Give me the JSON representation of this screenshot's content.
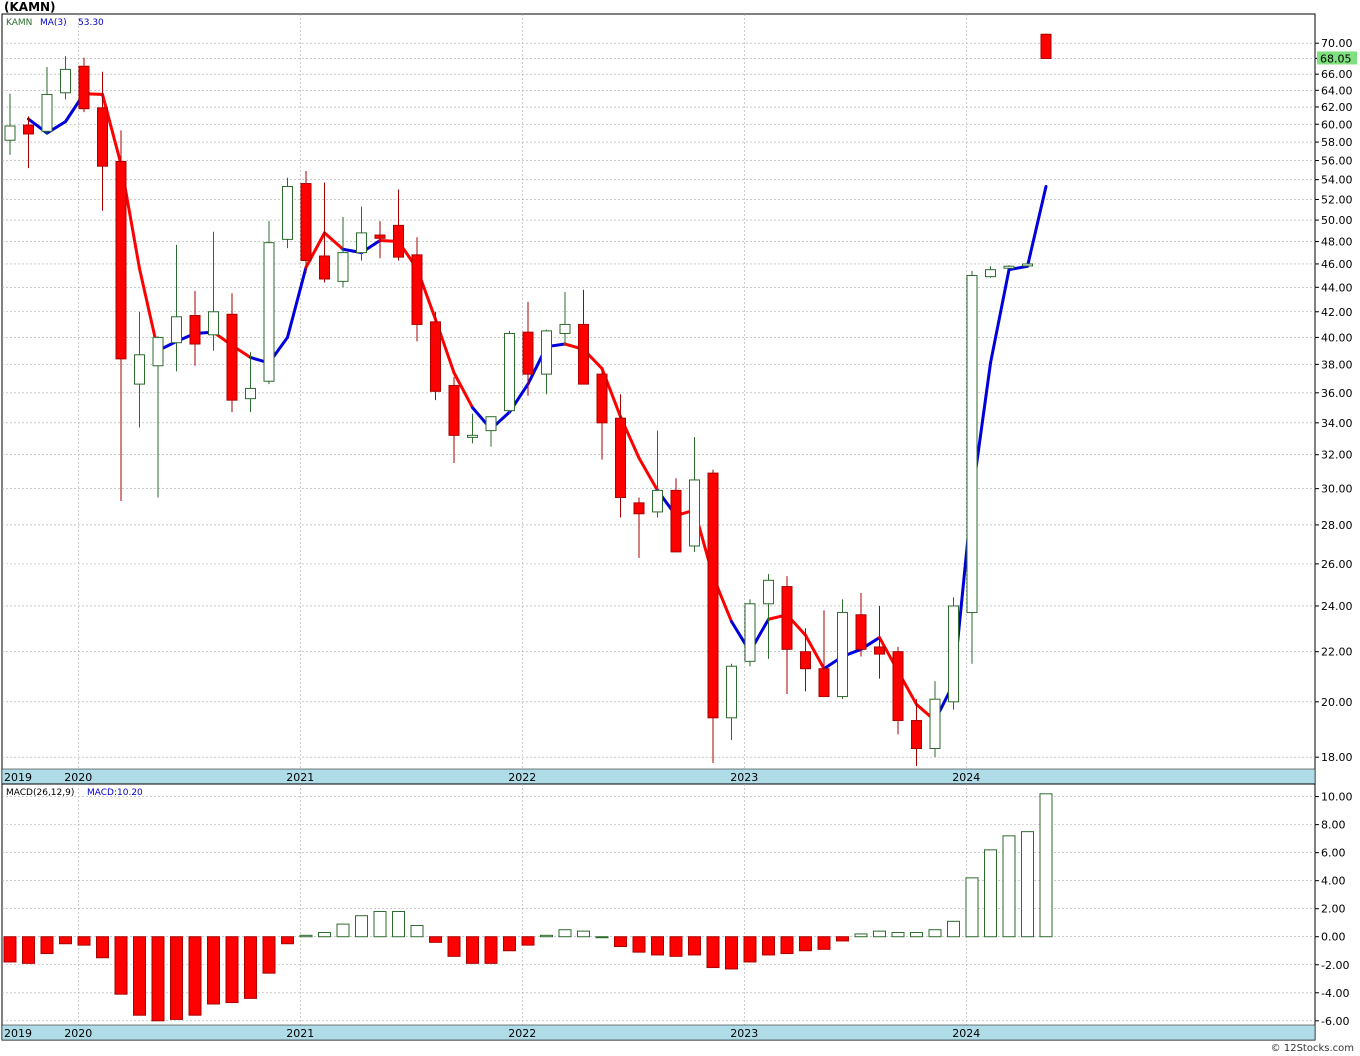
{
  "title": "(KAMN)",
  "watermark": "© 12Stocks.com",
  "colors": {
    "up_candle": "#2e6b2e",
    "down_candle": "#ff0000",
    "ma_up": "#0000dd",
    "ma_down": "#ff0000",
    "year_band": "#b0dce8",
    "last_price_badge": "#7ee07e",
    "grid": "#aaaaaa"
  },
  "chart_data": [
    {
      "type": "candlestick",
      "legend": {
        "symbol": "KAMN",
        "ma_label": "MA(3)",
        "ma_value": "53.30"
      },
      "last_price_label": "68.05",
      "ylim": [
        17.6,
        74.0
      ],
      "y_scale": "log",
      "y_ticks": [
        "18.00",
        "20.00",
        "22.00",
        "24.00",
        "26.00",
        "28.00",
        "30.00",
        "32.00",
        "34.00",
        "36.00",
        "38.00",
        "40.00",
        "42.00",
        "44.00",
        "46.00",
        "48.00",
        "50.00",
        "52.00",
        "54.00",
        "56.00",
        "58.00",
        "60.00",
        "62.00",
        "64.00",
        "66.00",
        "68.00",
        "70.00"
      ],
      "x_year_labels": [
        {
          "label": "2019",
          "index": -0.3
        },
        {
          "label": "2020",
          "index": 3.8
        },
        {
          "label": "2021",
          "index": 15.8
        },
        {
          "label": "2022",
          "index": 27.8
        },
        {
          "label": "2023",
          "index": 39.8
        },
        {
          "label": "2024",
          "index": 51.8
        }
      ],
      "candles": [
        {
          "o": 58.2,
          "h": 63.6,
          "l": 56.6,
          "c": 59.8
        },
        {
          "o": 59.9,
          "h": 60.9,
          "l": 55.2,
          "c": 58.9
        },
        {
          "o": 59.2,
          "h": 66.9,
          "l": 58.8,
          "c": 63.5
        },
        {
          "o": 63.7,
          "h": 68.3,
          "l": 62.9,
          "c": 66.6
        },
        {
          "o": 67.0,
          "h": 68.1,
          "l": 61.4,
          "c": 61.8
        },
        {
          "o": 61.9,
          "h": 66.3,
          "l": 50.9,
          "c": 55.4
        },
        {
          "o": 55.9,
          "h": 59.3,
          "l": 29.3,
          "c": 38.4
        },
        {
          "o": 36.6,
          "h": 42.0,
          "l": 33.7,
          "c": 38.7
        },
        {
          "o": 37.9,
          "h": 40.1,
          "l": 29.5,
          "c": 40.0
        },
        {
          "o": 39.6,
          "h": 47.7,
          "l": 37.5,
          "c": 41.6
        },
        {
          "o": 41.7,
          "h": 43.7,
          "l": 37.9,
          "c": 39.5
        },
        {
          "o": 40.2,
          "h": 48.9,
          "l": 39.0,
          "c": 42.0
        },
        {
          "o": 41.8,
          "h": 43.5,
          "l": 34.7,
          "c": 35.5
        },
        {
          "o": 35.6,
          "h": 38.9,
          "l": 34.7,
          "c": 36.3
        },
        {
          "o": 36.8,
          "h": 49.9,
          "l": 36.6,
          "c": 47.9
        },
        {
          "o": 48.2,
          "h": 54.2,
          "l": 47.4,
          "c": 53.3
        },
        {
          "o": 53.6,
          "h": 54.9,
          "l": 45.2,
          "c": 46.3
        },
        {
          "o": 46.7,
          "h": 53.7,
          "l": 44.4,
          "c": 44.7
        },
        {
          "o": 44.5,
          "h": 50.3,
          "l": 44.0,
          "c": 47.0
        },
        {
          "o": 47.0,
          "h": 51.3,
          "l": 46.3,
          "c": 48.8
        },
        {
          "o": 48.6,
          "h": 49.9,
          "l": 46.5,
          "c": 48.3
        },
        {
          "o": 49.5,
          "h": 53.0,
          "l": 46.3,
          "c": 46.6
        },
        {
          "o": 46.8,
          "h": 48.4,
          "l": 39.7,
          "c": 41.0
        },
        {
          "o": 41.2,
          "h": 42.0,
          "l": 35.5,
          "c": 36.1
        },
        {
          "o": 36.5,
          "h": 37.1,
          "l": 31.5,
          "c": 33.2
        },
        {
          "o": 33.2,
          "h": 34.6,
          "l": 32.7,
          "c": 33.2
        },
        {
          "o": 33.5,
          "h": 34.3,
          "l": 32.5,
          "c": 34.4
        },
        {
          "o": 34.8,
          "h": 40.5,
          "l": 34.6,
          "c": 40.3
        },
        {
          "o": 40.4,
          "h": 42.8,
          "l": 35.8,
          "c": 37.3
        },
        {
          "o": 37.3,
          "h": 40.6,
          "l": 35.9,
          "c": 40.5
        },
        {
          "o": 40.3,
          "h": 43.6,
          "l": 39.4,
          "c": 41.0
        },
        {
          "o": 41.0,
          "h": 43.8,
          "l": 36.6,
          "c": 36.6
        },
        {
          "o": 37.3,
          "h": 37.5,
          "l": 31.7,
          "c": 34.0
        },
        {
          "o": 34.3,
          "h": 35.9,
          "l": 28.4,
          "c": 29.5
        },
        {
          "o": 29.2,
          "h": 29.5,
          "l": 26.3,
          "c": 28.6
        },
        {
          "o": 28.7,
          "h": 33.5,
          "l": 28.4,
          "c": 29.9
        },
        {
          "o": 29.9,
          "h": 30.6,
          "l": 26.6,
          "c": 26.6
        },
        {
          "o": 26.9,
          "h": 33.1,
          "l": 26.6,
          "c": 30.5
        },
        {
          "o": 30.9,
          "h": 31.1,
          "l": 17.8,
          "c": 19.4
        },
        {
          "o": 19.4,
          "h": 21.5,
          "l": 18.6,
          "c": 21.4
        },
        {
          "o": 21.6,
          "h": 24.3,
          "l": 21.4,
          "c": 24.1
        },
        {
          "o": 24.1,
          "h": 25.5,
          "l": 21.7,
          "c": 25.2
        },
        {
          "o": 24.9,
          "h": 25.4,
          "l": 20.3,
          "c": 22.1
        },
        {
          "o": 22.0,
          "h": 23.0,
          "l": 20.4,
          "c": 21.3
        },
        {
          "o": 21.3,
          "h": 23.8,
          "l": 20.2,
          "c": 20.2
        },
        {
          "o": 20.2,
          "h": 24.3,
          "l": 20.1,
          "c": 23.7
        },
        {
          "o": 23.6,
          "h": 24.6,
          "l": 21.8,
          "c": 22.1
        },
        {
          "o": 22.2,
          "h": 24.0,
          "l": 20.9,
          "c": 21.9
        },
        {
          "o": 22.0,
          "h": 22.2,
          "l": 18.8,
          "c": 19.3
        },
        {
          "o": 19.3,
          "h": 20.1,
          "l": 17.7,
          "c": 18.3
        },
        {
          "o": 18.3,
          "h": 20.8,
          "l": 18.0,
          "c": 20.1
        },
        {
          "o": 20.0,
          "h": 24.4,
          "l": 19.7,
          "c": 24.0
        },
        {
          "o": 23.7,
          "h": 45.4,
          "l": 21.5,
          "c": 45.0
        },
        {
          "o": 44.9,
          "h": 45.8,
          "l": 44.8,
          "c": 45.5
        },
        {
          "o": 45.7,
          "h": 45.9,
          "l": 45.6,
          "c": 45.8
        },
        {
          "o": 45.9,
          "h": 46.0,
          "l": 45.9,
          "c": 46.0
        },
        {
          "o": 71.2,
          "h": 71.3,
          "l": 68.0,
          "c": 68.0
        }
      ],
      "ma3": [
        null,
        60.6,
        59.0,
        60.3,
        63.6,
        63.5,
        55.6,
        45.6,
        39.0,
        39.7,
        40.3,
        40.4,
        39.4,
        38.5,
        38.1,
        40.0,
        45.7,
        48.8,
        47.3,
        47.0,
        48.1,
        48.0,
        45.6,
        41.4,
        37.4,
        35.0,
        33.6,
        34.7,
        36.6,
        39.3,
        39.5,
        39.1,
        37.7,
        34.4,
        31.8,
        29.9,
        28.5,
        28.8,
        25.4,
        23.3,
        22.0,
        23.4,
        23.6,
        22.7,
        21.3,
        21.8,
        22.1,
        22.6,
        21.2,
        19.9,
        19.3,
        20.7,
        29.5,
        38.1,
        45.5,
        45.8,
        53.3
      ],
      "ma_color_series": [
        "",
        "red",
        "blue",
        "blue",
        "blue",
        "red",
        "red",
        "red",
        "red",
        "blue",
        "blue",
        "blue",
        "red",
        "red",
        "blue",
        "blue",
        "blue",
        "red",
        "red",
        "blue",
        "blue",
        "red",
        "red",
        "red",
        "red",
        "red",
        "blue",
        "blue",
        "blue",
        "blue",
        "blue",
        "red",
        "red",
        "red",
        "red",
        "red",
        "blue",
        "red",
        "red",
        "red",
        "blue",
        "blue",
        "red",
        "red",
        "red",
        "blue",
        "blue",
        "blue",
        "red",
        "red",
        "red",
        "blue",
        "blue",
        "blue",
        "blue",
        "blue",
        "blue"
      ]
    },
    {
      "type": "bar",
      "legend": {
        "indicator": "MACD(26,12,9)",
        "value_label": "MACD:10.20"
      },
      "ylim": [
        -6.3,
        10.9
      ],
      "y_ticks": [
        "-6.00",
        "-4.00",
        "-2.00",
        "0.00",
        "2.00",
        "4.00",
        "6.00",
        "8.00",
        "10.00"
      ],
      "x_year_labels": [
        {
          "label": "2019",
          "index": -0.3
        },
        {
          "label": "2020",
          "index": 3.8
        },
        {
          "label": "2021",
          "index": 15.8
        },
        {
          "label": "2022",
          "index": 27.8
        },
        {
          "label": "2023",
          "index": 39.8
        },
        {
          "label": "2024",
          "index": 51.8
        }
      ],
      "values": [
        -1.8,
        -1.9,
        -1.2,
        -0.5,
        -0.6,
        -1.5,
        -4.1,
        -5.6,
        -6.0,
        -5.9,
        -5.6,
        -4.8,
        -4.7,
        -4.4,
        -2.6,
        -0.5,
        0.1,
        0.3,
        0.9,
        1.5,
        1.8,
        1.8,
        0.8,
        -0.4,
        -1.4,
        -1.9,
        -1.9,
        -1.0,
        -0.6,
        0.1,
        0.5,
        0.4,
        0.0,
        -0.7,
        -1.1,
        -1.3,
        -1.4,
        -1.3,
        -2.2,
        -2.3,
        -1.8,
        -1.3,
        -1.2,
        -1.0,
        -0.9,
        -0.3,
        0.2,
        0.4,
        0.3,
        0.3,
        0.5,
        1.1,
        4.2,
        6.2,
        7.2,
        7.5,
        10.2
      ]
    }
  ]
}
